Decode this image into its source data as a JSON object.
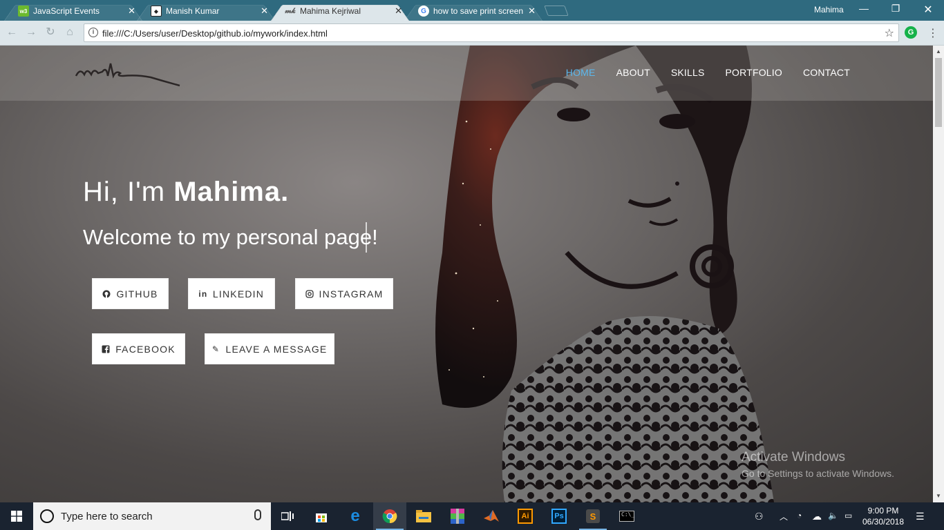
{
  "browser": {
    "tabs": [
      {
        "title": "JavaScript Events",
        "favicon": "w3schools-icon",
        "active": false
      },
      {
        "title": "Manish Kumar",
        "favicon": "site-icon",
        "active": false
      },
      {
        "title": "Mahima Kejriwal",
        "favicon": "mk-signature-icon",
        "active": true
      },
      {
        "title": "how to save print screen",
        "favicon": "google-icon",
        "active": false
      }
    ],
    "profile_name": "Mahima",
    "url": "file:///C:/Users/user/Desktop/github.io/mywork/index.html"
  },
  "site": {
    "nav": [
      "HOME",
      "ABOUT",
      "SKILLS",
      "PORTFOLIO",
      "CONTACT"
    ],
    "active_nav": "HOME",
    "hero_greeting": "Hi, I'm ",
    "hero_name": "Mahima.",
    "hero_sub": "Welcome to my personal page!",
    "buttons": {
      "github": "GITHUB",
      "linkedin": "LINKEDIN",
      "instagram": "INSTAGRAM",
      "facebook": "FACEBOOK",
      "message": "LEAVE A MESSAGE"
    },
    "accent": "#5bb8ee"
  },
  "watermark": {
    "line1": "Activate Windows",
    "line2": "Go to Settings to activate Windows."
  },
  "taskbar": {
    "search_placeholder": "Type here to search",
    "time": "9:00 PM",
    "date": "06/30/2018"
  }
}
